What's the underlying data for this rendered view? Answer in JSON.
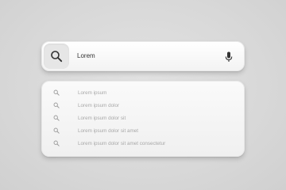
{
  "search": {
    "value": "Lorem",
    "search_icon": "search-icon",
    "mic_icon": "microphone-icon"
  },
  "suggestions": [
    {
      "label": "Lorem ipsum"
    },
    {
      "label": "Lorem ipsum dolor"
    },
    {
      "label": "Lorem ipsum dolor sit"
    },
    {
      "label": "Lorem ipsum dolor sit amet"
    },
    {
      "label": "Lorem ipsum dolor sit amet consectetur"
    }
  ],
  "colors": {
    "background": "#d9d9d9",
    "panel": "#f7f7f7",
    "icon_button": "#e6e6e6",
    "text": "#333333",
    "suggestion_text": "#a8a8a8"
  }
}
